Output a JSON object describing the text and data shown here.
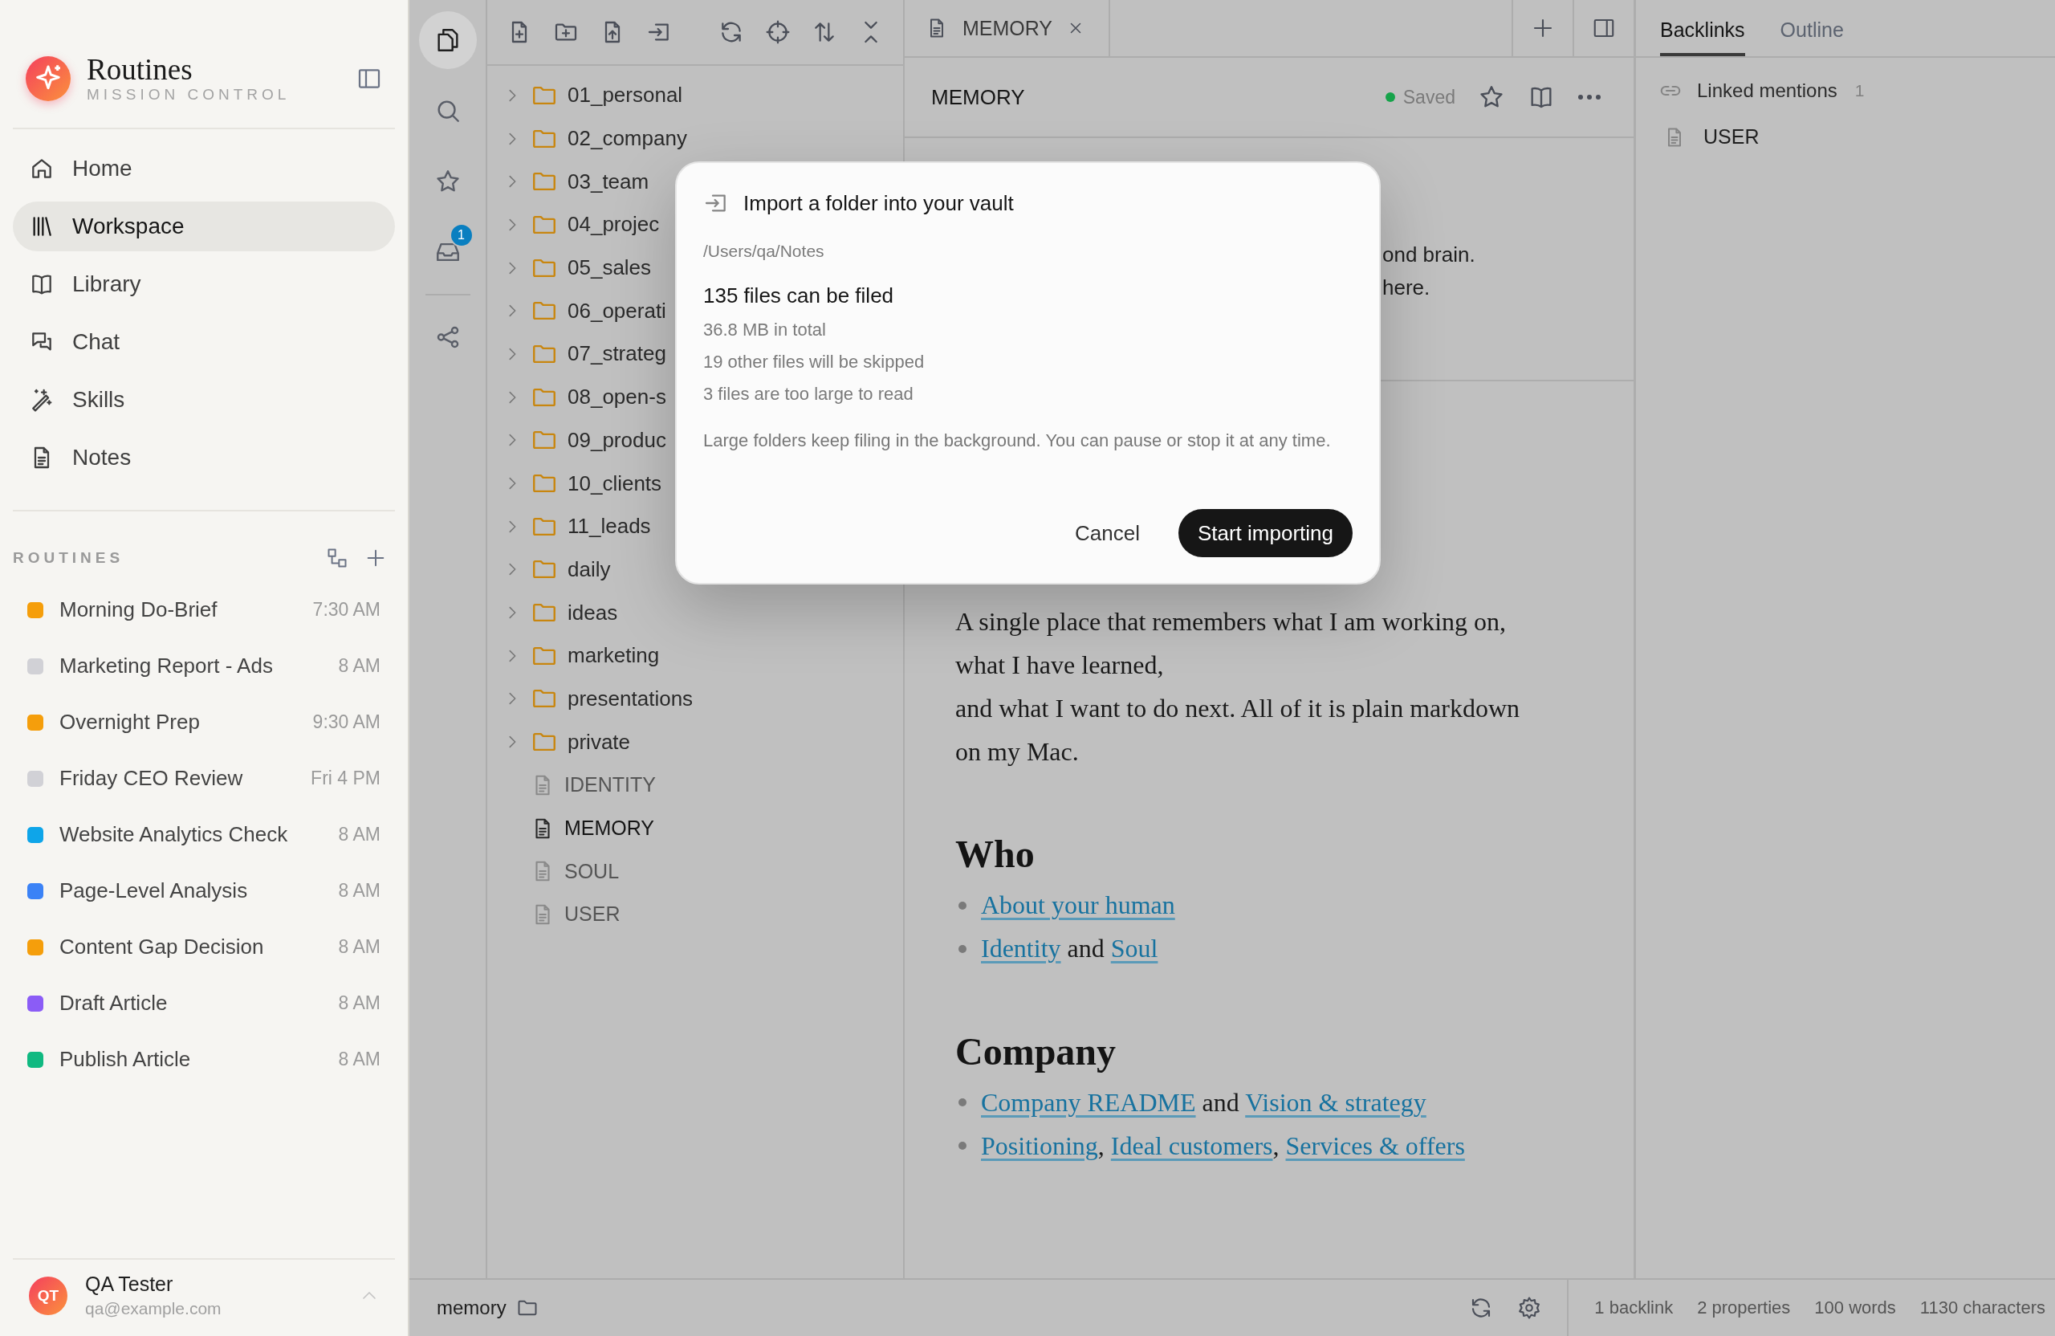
{
  "sidebar": {
    "app_name": "Routines",
    "app_subtitle": "MISSION CONTROL",
    "nav": [
      {
        "label": "Home",
        "selected": false
      },
      {
        "label": "Workspace",
        "selected": true
      },
      {
        "label": "Library",
        "selected": false
      },
      {
        "label": "Chat",
        "selected": false
      },
      {
        "label": "Skills",
        "selected": false
      },
      {
        "label": "Notes",
        "selected": false
      }
    ],
    "routines_heading": "ROUTINES",
    "routines": [
      {
        "name": "Morning Do-Brief",
        "time": "7:30 AM",
        "color": "#f59e0b"
      },
      {
        "name": "Marketing Report - Ads",
        "time": "8 AM",
        "color": "#d1d1d6"
      },
      {
        "name": "Overnight Prep",
        "time": "9:30 AM",
        "color": "#f59e0b"
      },
      {
        "name": "Friday CEO Review",
        "time": "Fri 4 PM",
        "color": "#d1d1d6"
      },
      {
        "name": "Website Analytics Check",
        "time": "8 AM",
        "color": "#0ea5e9"
      },
      {
        "name": "Page-Level Analysis",
        "time": "8 AM",
        "color": "#3b82f6"
      },
      {
        "name": "Content Gap Decision",
        "time": "8 AM",
        "color": "#f59e0b"
      },
      {
        "name": "Draft Article",
        "time": "8 AM",
        "color": "#8b5cf6"
      },
      {
        "name": "Publish Article",
        "time": "8 AM",
        "color": "#10b981"
      }
    ],
    "user": {
      "initials": "QT",
      "name": "QA Tester",
      "email": "qa@example.com"
    }
  },
  "rail": [
    {
      "selected": true
    },
    {
      "selected": false
    },
    {
      "selected": false
    },
    {
      "selected": false,
      "badge": "1"
    },
    {
      "selected": false
    }
  ],
  "file_tree": [
    {
      "name": "01_personal",
      "kind": "folder",
      "expanded": false,
      "selected": false
    },
    {
      "name": "02_company",
      "kind": "folder",
      "expanded": false,
      "selected": false
    },
    {
      "name": "03_team",
      "kind": "folder",
      "expanded": false,
      "selected": false
    },
    {
      "name": "04_projec",
      "kind": "folder",
      "expanded": false,
      "selected": false
    },
    {
      "name": "05_sales",
      "kind": "folder",
      "expanded": false,
      "selected": false
    },
    {
      "name": "06_operati",
      "kind": "folder",
      "expanded": false,
      "selected": false
    },
    {
      "name": "07_strateg",
      "kind": "folder",
      "expanded": false,
      "selected": false
    },
    {
      "name": "08_open-s",
      "kind": "folder",
      "expanded": false,
      "selected": false
    },
    {
      "name": "09_produc",
      "kind": "folder",
      "expanded": false,
      "selected": false
    },
    {
      "name": "10_clients",
      "kind": "folder",
      "expanded": false,
      "selected": false
    },
    {
      "name": "11_leads",
      "kind": "folder",
      "expanded": false,
      "selected": false
    },
    {
      "name": "daily",
      "kind": "folder",
      "expanded": false,
      "selected": false
    },
    {
      "name": "ideas",
      "kind": "folder",
      "expanded": false,
      "selected": false
    },
    {
      "name": "marketing",
      "kind": "folder",
      "expanded": false,
      "selected": false
    },
    {
      "name": "presentations",
      "kind": "folder",
      "expanded": false,
      "selected": false
    },
    {
      "name": "private",
      "kind": "folder",
      "expanded": false,
      "selected": false
    },
    {
      "name": "IDENTITY",
      "kind": "file",
      "selected": false
    },
    {
      "name": "MEMORY",
      "kind": "file",
      "selected": true
    },
    {
      "name": "SOUL",
      "kind": "file",
      "selected": false
    },
    {
      "name": "USER",
      "kind": "file",
      "selected": false
    }
  ],
  "tab": {
    "title": "MEMORY"
  },
  "note": {
    "title": "MEMORY",
    "status": "Saved",
    "intro_fragments": [
      "ond brain.",
      "here."
    ],
    "paragraph_lines": [
      "A single place that remembers what I am working on,",
      "what I have learned,",
      "and what I want to do next. All of it is plain markdown",
      "on my Mac."
    ],
    "sections": [
      {
        "heading": "Who",
        "items": [
          [
            {
              "text": "About your human",
              "kind": "link"
            }
          ],
          [
            {
              "text": "Identity",
              "kind": "link"
            },
            {
              "text": " and ",
              "kind": "text"
            },
            {
              "text": "Soul",
              "kind": "link"
            }
          ]
        ]
      },
      {
        "heading": "Company",
        "items": [
          [
            {
              "text": "Company README",
              "kind": "link"
            },
            {
              "text": " and ",
              "kind": "text"
            },
            {
              "text": "Vision & strategy",
              "kind": "link"
            }
          ],
          [
            {
              "text": "Positioning",
              "kind": "link"
            },
            {
              "text": ", ",
              "kind": "text"
            },
            {
              "text": "Ideal customers",
              "kind": "link"
            },
            {
              "text": ", ",
              "kind": "text"
            },
            {
              "text": "Services & offers",
              "kind": "link"
            }
          ]
        ]
      }
    ]
  },
  "right_panel": {
    "tabs": [
      {
        "label": "Backlinks",
        "selected": true
      },
      {
        "label": "Outline",
        "selected": false
      }
    ],
    "linked_mentions": {
      "label": "Linked mentions",
      "count": "1",
      "items": [
        "USER"
      ]
    }
  },
  "status_bar": {
    "file": "memory",
    "stats": [
      "1 backlink",
      "2 properties",
      "100 words",
      "1130 characters"
    ]
  },
  "dialog": {
    "title": "Import a folder into your vault",
    "path": "/Users/qa/Notes",
    "summary": "135 files can be filed",
    "details": [
      "36.8 MB in total",
      "19 other files will be skipped",
      "3 files are too large to read"
    ],
    "note": "Large folders keep filing in the background. You can pause or stop it at any time.",
    "buttons": [
      {
        "label": "Cancel",
        "kind": "secondary"
      },
      {
        "label": "Start importing",
        "kind": "primary"
      }
    ]
  }
}
